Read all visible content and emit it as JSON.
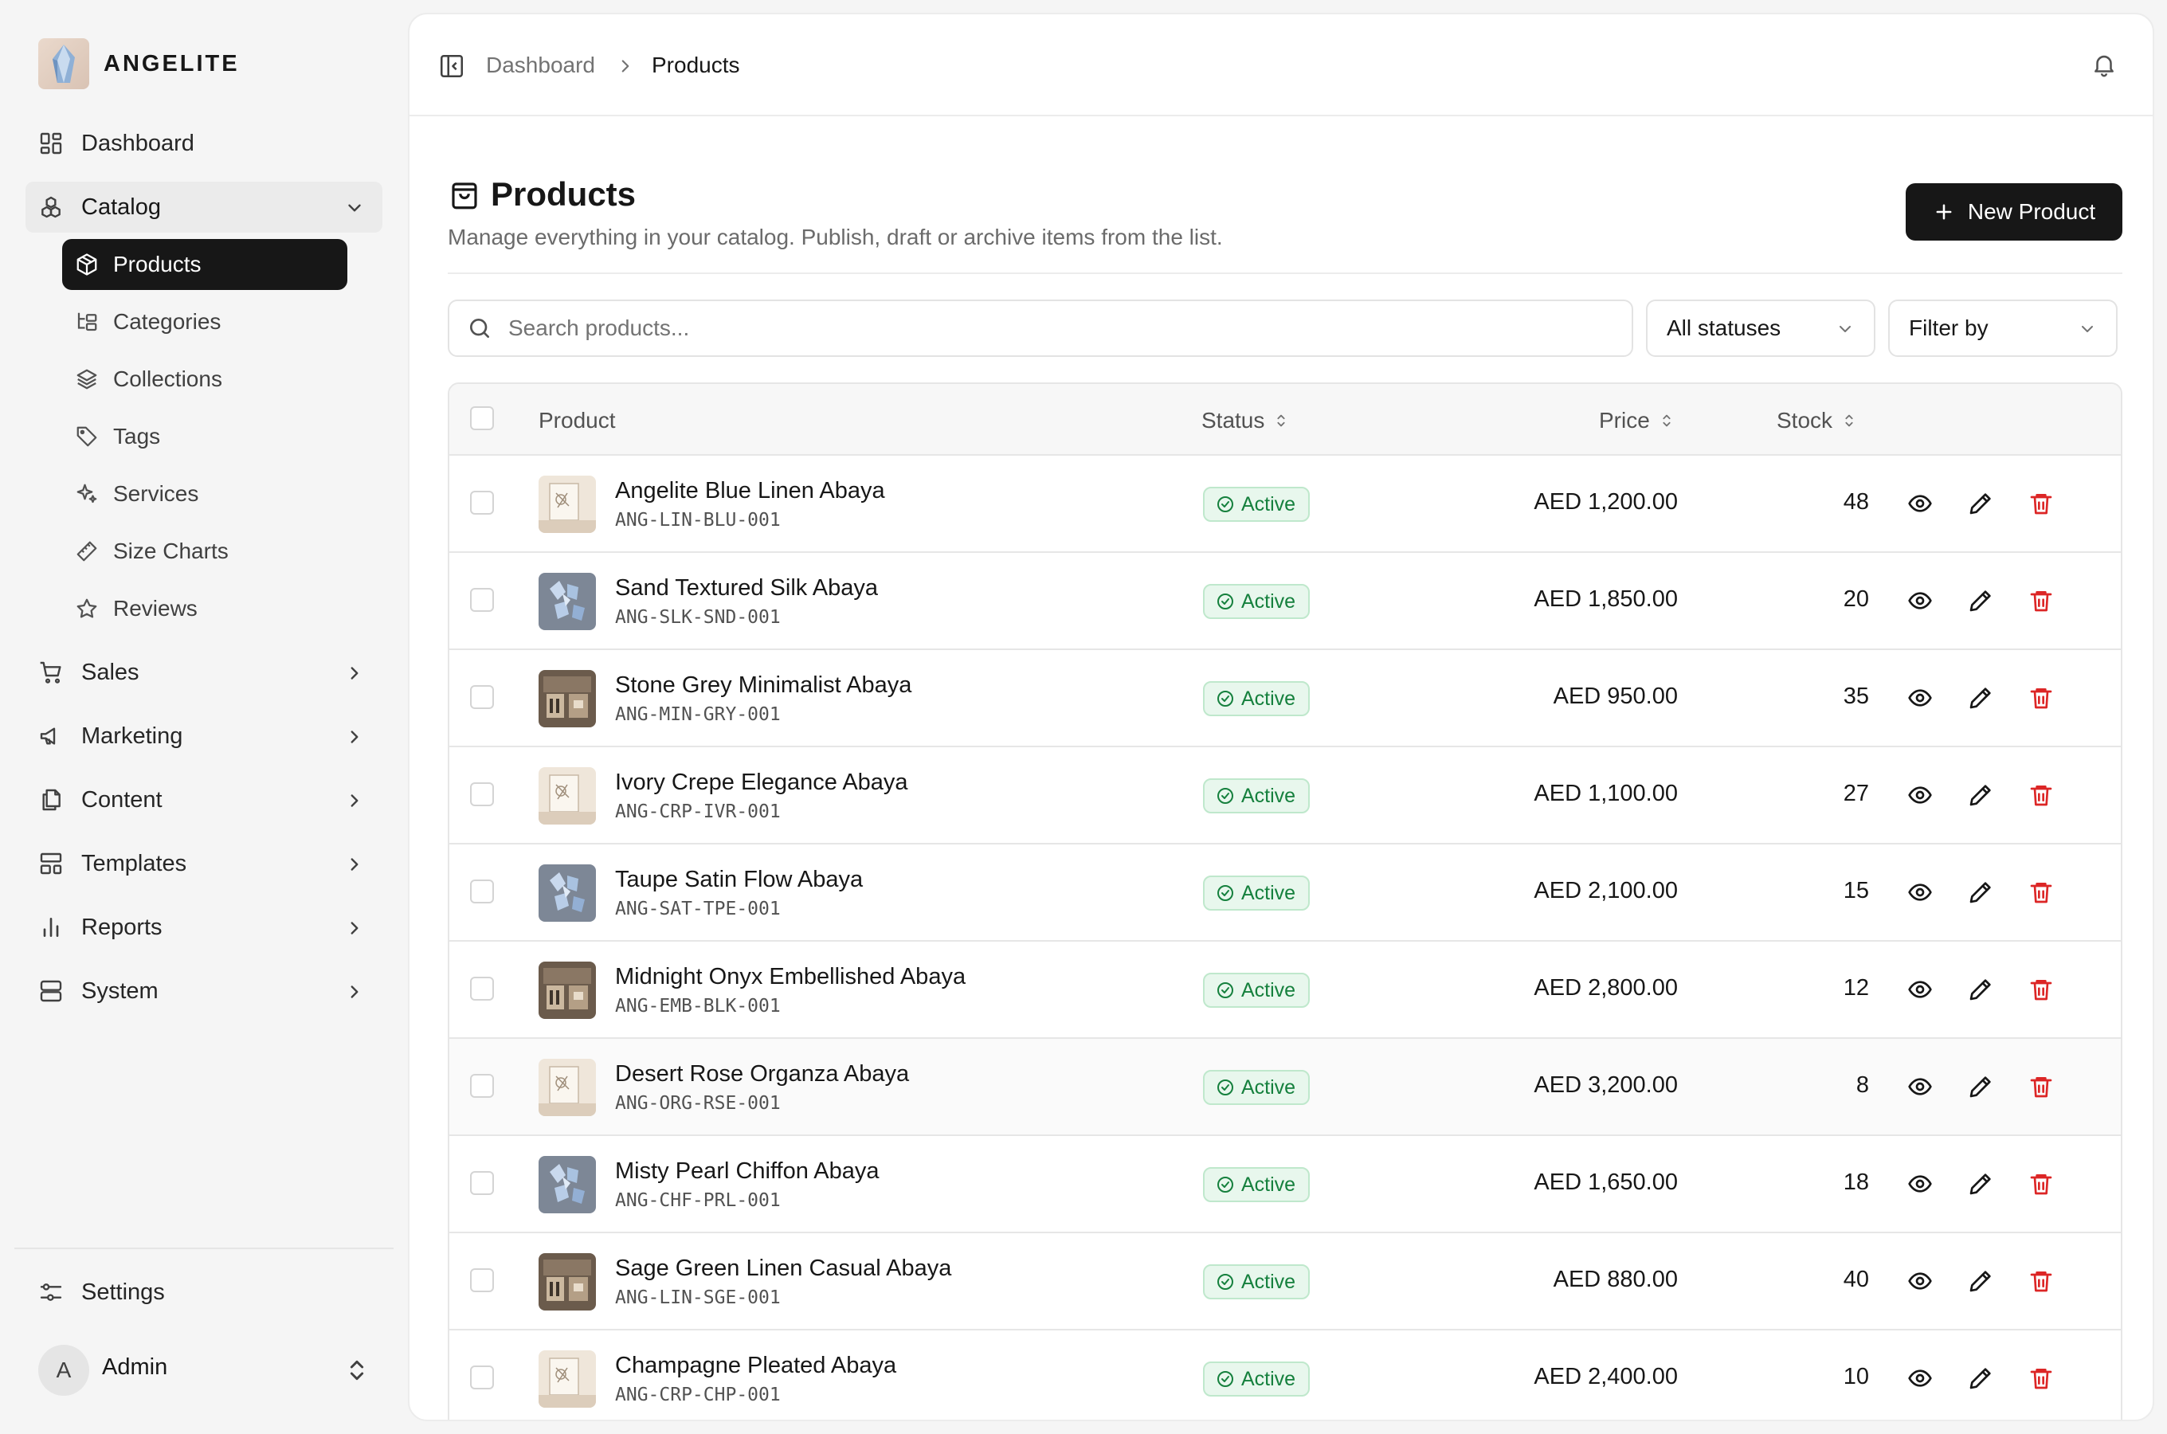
{
  "brand": {
    "name": "ANGELITE"
  },
  "sidebar": {
    "dashboard": "Dashboard",
    "catalog": "Catalog",
    "catalog_items": [
      "Products",
      "Categories",
      "Collections",
      "Tags",
      "Services",
      "Size Charts",
      "Reviews"
    ],
    "sections": [
      "Sales",
      "Marketing",
      "Content",
      "Templates",
      "Reports",
      "System"
    ],
    "settings": "Settings",
    "user": {
      "initial": "A",
      "name": "Admin"
    }
  },
  "breadcrumb": {
    "parent": "Dashboard",
    "current": "Products"
  },
  "page": {
    "title": "Products",
    "subtitle": "Manage everything in your catalog. Publish, draft or archive items from the list.",
    "new_button": "New Product"
  },
  "filters": {
    "search_placeholder": "Search products...",
    "status_select": "All statuses",
    "filter_select": "Filter by"
  },
  "table": {
    "headers": {
      "product": "Product",
      "status": "Status",
      "price": "Price",
      "stock": "Stock"
    },
    "rows": [
      {
        "name": "Angelite Blue Linen Abaya",
        "sku": "ANG-LIN-BLU-001",
        "status": "Active",
        "price": "AED 1,200.00",
        "stock": "48",
        "thumb": "sketch"
      },
      {
        "name": "Sand Textured Silk Abaya",
        "sku": "ANG-SLK-SND-001",
        "status": "Active",
        "price": "AED 1,850.00",
        "stock": "20",
        "thumb": "crystal"
      },
      {
        "name": "Stone Grey Minimalist Abaya",
        "sku": "ANG-MIN-GRY-001",
        "status": "Active",
        "price": "AED 950.00",
        "stock": "35",
        "thumb": "boutique"
      },
      {
        "name": "Ivory Crepe Elegance Abaya",
        "sku": "ANG-CRP-IVR-001",
        "status": "Active",
        "price": "AED 1,100.00",
        "stock": "27",
        "thumb": "sketch"
      },
      {
        "name": "Taupe Satin Flow Abaya",
        "sku": "ANG-SAT-TPE-001",
        "status": "Active",
        "price": "AED 2,100.00",
        "stock": "15",
        "thumb": "crystal"
      },
      {
        "name": "Midnight Onyx Embellished Abaya",
        "sku": "ANG-EMB-BLK-001",
        "status": "Active",
        "price": "AED 2,800.00",
        "stock": "12",
        "thumb": "boutique"
      },
      {
        "name": "Desert Rose Organza Abaya",
        "sku": "ANG-ORG-RSE-001",
        "status": "Active",
        "price": "AED 3,200.00",
        "stock": "8",
        "thumb": "sketch"
      },
      {
        "name": "Misty Pearl Chiffon Abaya",
        "sku": "ANG-CHF-PRL-001",
        "status": "Active",
        "price": "AED 1,650.00",
        "stock": "18",
        "thumb": "crystal"
      },
      {
        "name": "Sage Green Linen Casual Abaya",
        "sku": "ANG-LIN-SGE-001",
        "status": "Active",
        "price": "AED 880.00",
        "stock": "40",
        "thumb": "boutique"
      },
      {
        "name": "Champagne Pleated Abaya",
        "sku": "ANG-CRP-CHP-001",
        "status": "Active",
        "price": "AED 2,400.00",
        "stock": "10",
        "thumb": "sketch"
      }
    ]
  },
  "colors": {
    "accent": "#171717",
    "active_badge_bg": "#e8f7ed",
    "active_badge_text": "#15803d",
    "delete": "#dc2626"
  }
}
